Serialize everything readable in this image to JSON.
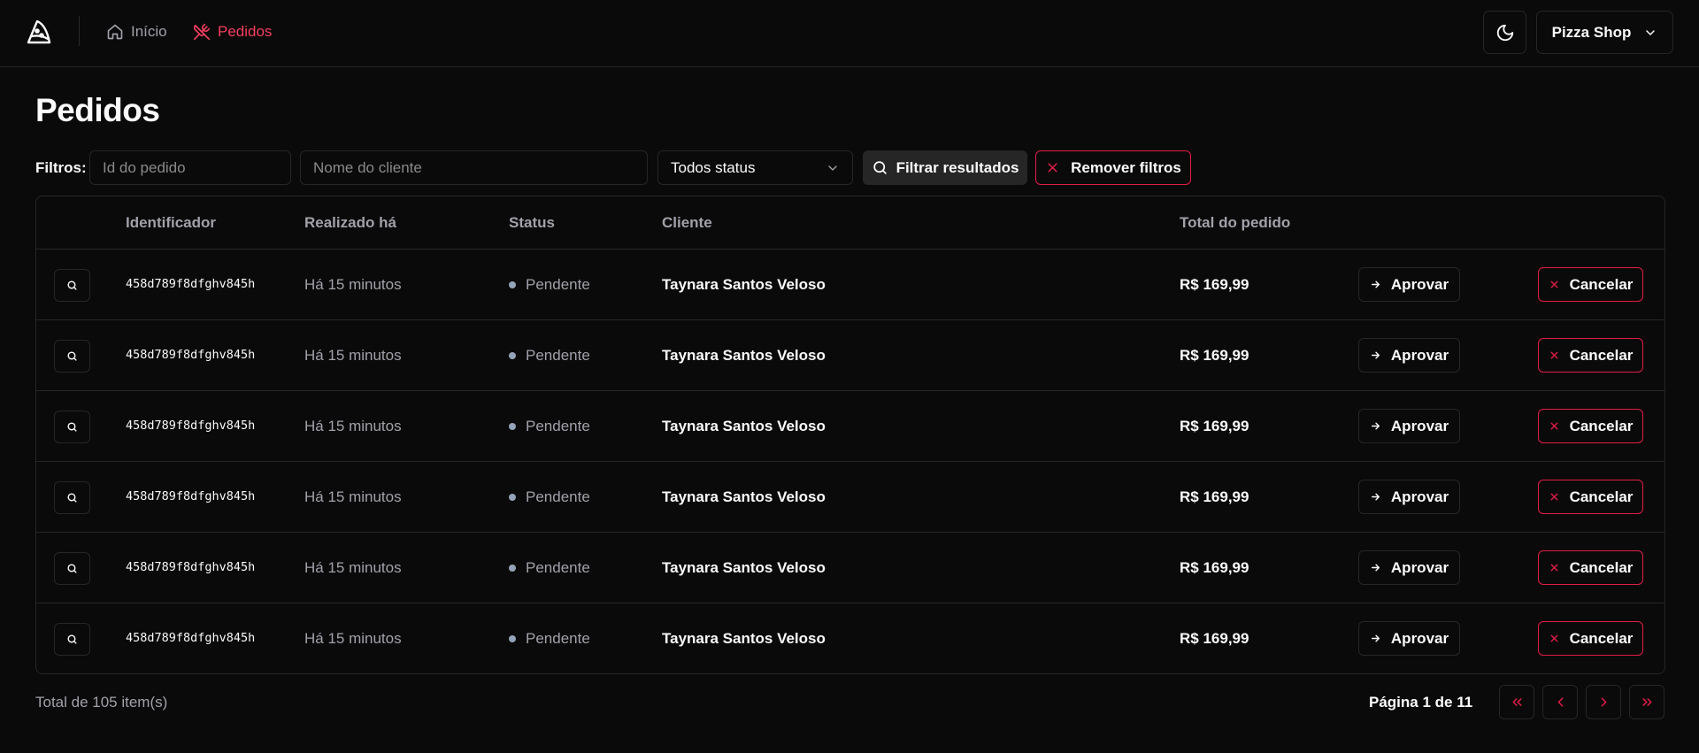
{
  "header": {
    "nav": [
      {
        "label": "Início",
        "icon": "home-icon",
        "active": false
      },
      {
        "label": "Pedidos",
        "icon": "utensils-crossed-icon",
        "active": true
      }
    ],
    "theme_icon": "moon-icon",
    "shop_label": "Pizza Shop"
  },
  "page": {
    "title": "Pedidos"
  },
  "filters": {
    "label": "Filtros:",
    "order_id_placeholder": "Id do pedido",
    "customer_placeholder": "Nome do cliente",
    "status_value": "Todos status",
    "filter_button": "Filtrar resultados",
    "remove_button": "Remover filtros"
  },
  "table": {
    "headers": [
      "",
      "Identificador",
      "Realizado há",
      "Status",
      "Cliente",
      "Total do pedido",
      "",
      ""
    ],
    "rows": [
      {
        "id": "458d789f8dfghv845h",
        "time": "Há 15 minutos",
        "status": "Pendente",
        "customer": "Taynara Santos Veloso",
        "total": "R$ 169,99",
        "approve": "Aprovar",
        "cancel": "Cancelar"
      },
      {
        "id": "458d789f8dfghv845h",
        "time": "Há 15 minutos",
        "status": "Pendente",
        "customer": "Taynara Santos Veloso",
        "total": "R$ 169,99",
        "approve": "Aprovar",
        "cancel": "Cancelar"
      },
      {
        "id": "458d789f8dfghv845h",
        "time": "Há 15 minutos",
        "status": "Pendente",
        "customer": "Taynara Santos Veloso",
        "total": "R$ 169,99",
        "approve": "Aprovar",
        "cancel": "Cancelar"
      },
      {
        "id": "458d789f8dfghv845h",
        "time": "Há 15 minutos",
        "status": "Pendente",
        "customer": "Taynara Santos Veloso",
        "total": "R$ 169,99",
        "approve": "Aprovar",
        "cancel": "Cancelar"
      },
      {
        "id": "458d789f8dfghv845h",
        "time": "Há 15 minutos",
        "status": "Pendente",
        "customer": "Taynara Santos Veloso",
        "total": "R$ 169,99",
        "approve": "Aprovar",
        "cancel": "Cancelar"
      },
      {
        "id": "458d789f8dfghv845h",
        "time": "Há 15 minutos",
        "status": "Pendente",
        "customer": "Taynara Santos Veloso",
        "total": "R$ 169,99",
        "approve": "Aprovar",
        "cancel": "Cancelar"
      }
    ]
  },
  "pagination": {
    "total": "Total de 105 item(s)",
    "page_info": "Página 1 de 11"
  },
  "colors": {
    "accent": "#e11d48",
    "background": "#0a0a0a",
    "border": "#262626",
    "status_pending": "#94a3b8"
  }
}
